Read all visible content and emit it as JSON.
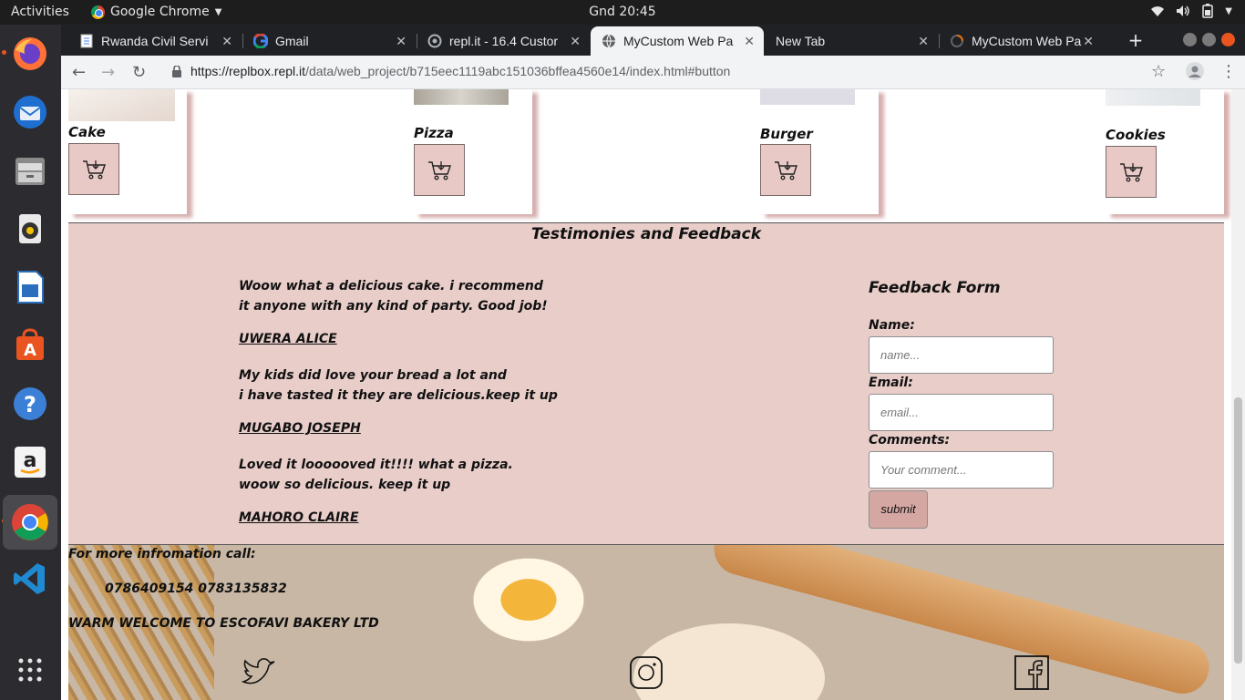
{
  "system": {
    "activities": "Activities",
    "app_name": "Google Chrome",
    "clock": "Gnd 20:45"
  },
  "tabs": [
    {
      "title": "Rwanda Civil Servi",
      "active": false
    },
    {
      "title": "Gmail",
      "active": false
    },
    {
      "title": "repl.it - 16.4 Custor",
      "active": false
    },
    {
      "title": "MyCustom Web Pa",
      "active": true
    },
    {
      "title": "New Tab",
      "active": false
    },
    {
      "title": "MyCustom Web Pa",
      "active": false
    }
  ],
  "browser": {
    "url_host": "https://replbox.repl.it",
    "url_path": "/data/web_project/b715eec1119abc151036bffea4560e14/index.html#button"
  },
  "products": [
    {
      "name": "Cake"
    },
    {
      "name": "Pizza"
    },
    {
      "name": "Burger"
    },
    {
      "name": "Cookies"
    }
  ],
  "testimonies": {
    "title": "Testimonies and Feedback",
    "items": [
      {
        "line1": "Woow what a delicious cake. i recommend",
        "line2": "it anyone with any kind of party. Good job!",
        "author": "UWERA ALICE"
      },
      {
        "line1": "My kids did love your bread a lot and",
        "line2": "i have tasted it they are delicious.keep it up",
        "author": "MUGABO JOSEPH"
      },
      {
        "line1": "Loved it loooooved it!!!! what a pizza.",
        "line2": "woow so delicious. keep it up",
        "author": "MAHORO CLAIRE"
      }
    ]
  },
  "feedback_form": {
    "title": "Feedback Form",
    "name_label": "Name:",
    "name_placeholder": "name...",
    "email_label": "Email:",
    "email_placeholder": "email...",
    "comments_label": "Comments:",
    "comments_placeholder": "Your comment...",
    "submit_label": "submit"
  },
  "footer": {
    "call_label": "For more infromation call:",
    "phones": "0786409154 0783135832",
    "welcome": "WARM WELCOME TO ESCOFAVI BAKERY LTD"
  },
  "icons": [
    "twitter-icon",
    "instagram-icon",
    "facebook-icon",
    "cart-icon"
  ],
  "colors": {
    "section_bg": "#e8cdc9",
    "cart_button_bg": "#e8c9c6",
    "submit_bg": "#d4a7a2"
  }
}
